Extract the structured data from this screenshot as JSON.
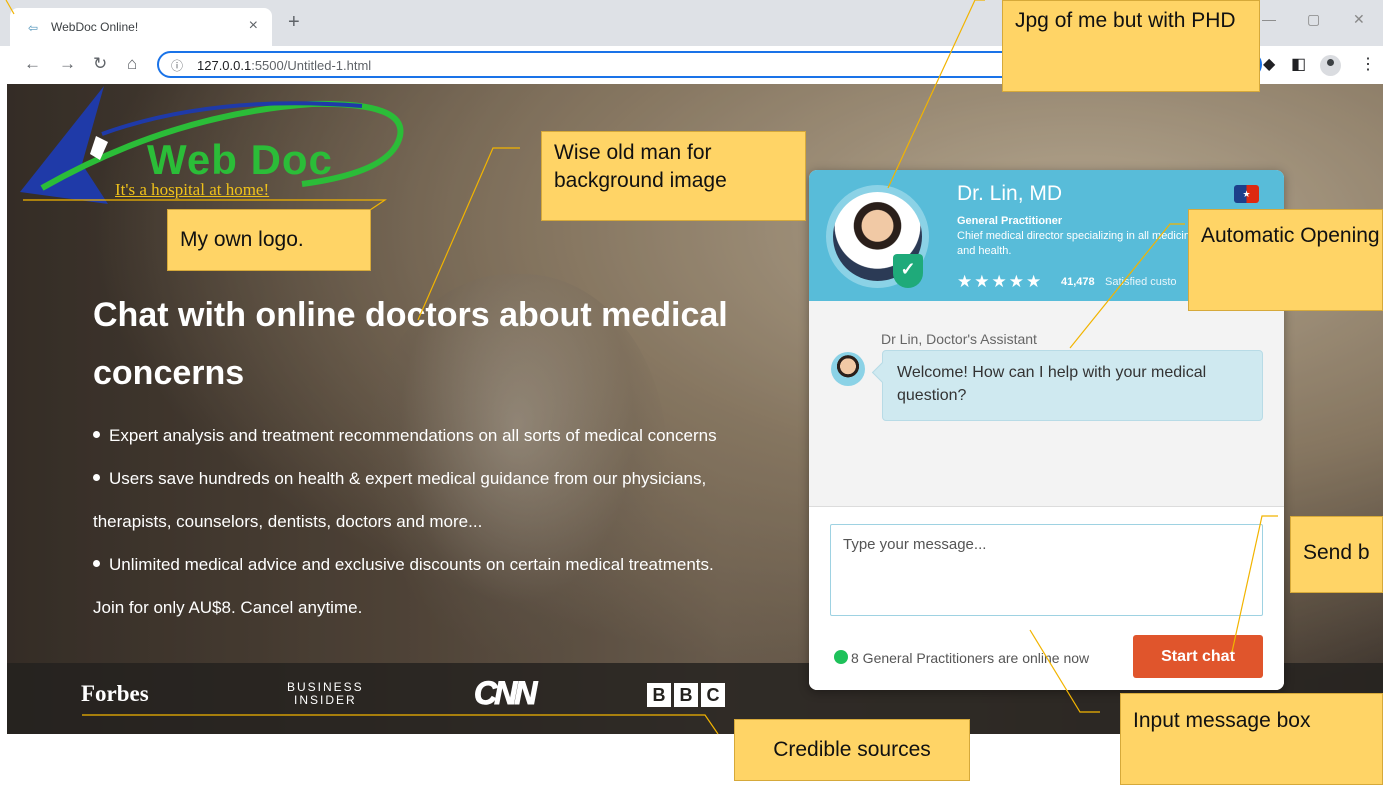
{
  "browser": {
    "tab_title": "WebDoc Online!",
    "tab_close": "×",
    "new_tab": "+",
    "url_host": "127.0.0.1",
    "url_rest": ":5500/Untitled-1.html",
    "info_icon": "ⓘ"
  },
  "logo": {
    "name": "Web Doc",
    "tagline": "It's a hospital at home!"
  },
  "hero": {
    "headline": "Chat with online doctors about medical concerns",
    "bullets": [
      "Expert analysis and treatment recommendations on all sorts of medical concerns",
      "Users save hundreds on health & expert medical guidance from our physicians,",
      "Unlimited medical advice and exclusive discounts on certain medical treatments."
    ],
    "bullet2_cont": "therapists, counselors, dentists, doctors and more...",
    "join_text": "Join for only AU$8. Cancel anytime."
  },
  "press": {
    "forbes": "Forbes",
    "business_insider_line1": "BUSINESS",
    "business_insider_line2": "INSIDER",
    "cnn": "CNN",
    "bbc": [
      "B",
      "B",
      "C"
    ]
  },
  "chat": {
    "doctor_name": "Dr. Lin, MD",
    "role": "General Practitioner",
    "description": "Chief medical director specializing in all medicine and health.",
    "stars": "★★★★★",
    "rating_count": "41,478",
    "rating_label": "Satisfied custo",
    "assistant_label": "Dr Lin, Doctor's Assistant",
    "welcome_message": "Welcome! How can I help with your medical question?",
    "input_placeholder": "Type your message...",
    "online_status": "8 General Practitioners are online now",
    "start_button": "Start chat"
  },
  "annotations": {
    "photo_note": "Jpg of me but with PHD",
    "background_note": "Wise old man for background image",
    "logo_note": "My own logo.",
    "opening_note": "Automatic Opening questi",
    "send_note": "Send b",
    "input_note": "Input message box",
    "sources_note": "Credible sources"
  },
  "colors": {
    "accent_blue": "#58bcd9",
    "start_button": "#e0552c",
    "logo_green": "#2bbd38",
    "note_yellow": "#ffd466",
    "online_green": "#1ec15a"
  }
}
